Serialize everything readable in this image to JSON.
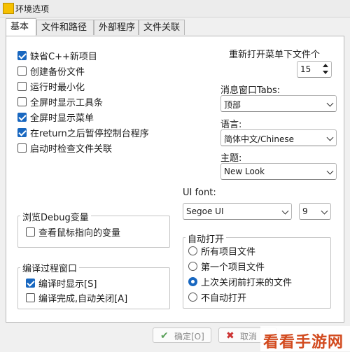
{
  "window": {
    "title": "环境选项"
  },
  "tabs": [
    {
      "label": "基本"
    },
    {
      "label": "文件和路径"
    },
    {
      "label": "外部程序"
    },
    {
      "label": "文件关联"
    }
  ],
  "options": [
    {
      "label": "缺省C++新项目",
      "checked": true
    },
    {
      "label": "创建备份文件",
      "checked": false
    },
    {
      "label": "运行时最小化",
      "checked": false
    },
    {
      "label": "全屏时显示工具条",
      "checked": false
    },
    {
      "label": "全屏时显示菜单",
      "checked": true
    },
    {
      "label": "在return之后暂停控制台程序",
      "checked": true
    },
    {
      "label": "启动时检查文件关联",
      "checked": false
    }
  ],
  "reopen": {
    "label": "重新打开菜单下文件个",
    "value": "15"
  },
  "messages": {
    "label": "消息窗口Tabs:",
    "value": "顶部"
  },
  "language": {
    "label": "语言:",
    "value": "简体中文/Chinese"
  },
  "theme": {
    "label": "主题:",
    "value": "New Look"
  },
  "uifont": {
    "label": "UI font:",
    "font": "Segoe UI",
    "size": "9"
  },
  "debug_group": {
    "title": "浏览Debug变量",
    "options": [
      {
        "label": "查看鼠标指向的变量",
        "checked": false
      }
    ]
  },
  "compile_group": {
    "title": "编译过程窗口",
    "options": [
      {
        "label": "编译时显示[S]",
        "checked": true
      },
      {
        "label": "编译完成,自动关闭[A]",
        "checked": false
      }
    ]
  },
  "autoopen_group": {
    "title": "自动打开",
    "options": [
      {
        "label": "所有项目文件",
        "selected": false
      },
      {
        "label": "第一个项目文件",
        "selected": false
      },
      {
        "label": "上次关闭前打来的文件",
        "selected": true
      },
      {
        "label": "不自动打开",
        "selected": false
      }
    ]
  },
  "buttons": {
    "ok": "确定[O]",
    "cancel": "取消"
  },
  "watermark": "看看手游网",
  "colors": {
    "accent": "#1867c0",
    "watermark": "#d24a1e"
  }
}
